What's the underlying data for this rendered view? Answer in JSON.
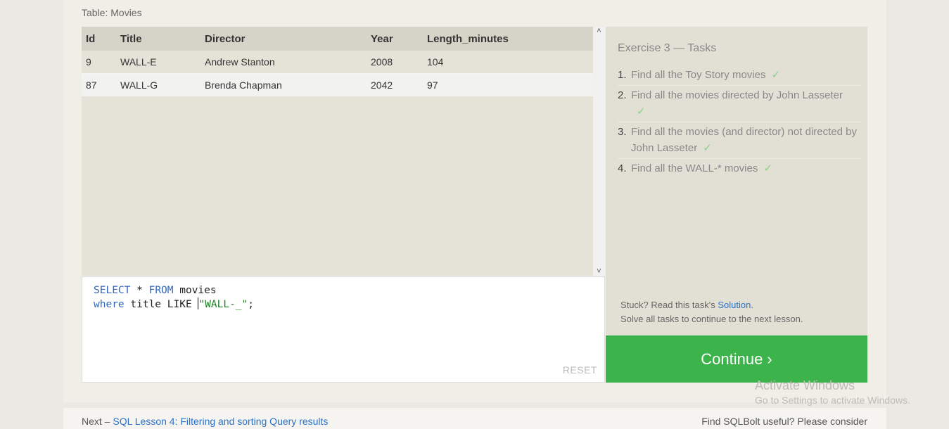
{
  "table_label": "Table: Movies",
  "columns": [
    "Id",
    "Title",
    "Director",
    "Year",
    "Length_minutes"
  ],
  "rows": [
    [
      "9",
      "WALL-E",
      "Andrew Stanton",
      "2008",
      "104"
    ],
    [
      "87",
      "WALL-G",
      "Brenda Chapman",
      "2042",
      "97"
    ]
  ],
  "editor": {
    "line1": {
      "kw1": "SELECT",
      "mid": " * ",
      "kw2": "FROM",
      "rest": " movies"
    },
    "line2": {
      "kw": "where",
      "mid": " title LIKE ",
      "str": "\"WALL-_\"",
      "end": ";"
    },
    "reset_label": "RESET"
  },
  "tasks": {
    "title": "Exercise 3 — Tasks",
    "items": [
      {
        "num": "1.",
        "text": "Find all the Toy Story movies",
        "check": "✓"
      },
      {
        "num": "2.",
        "text": "Find all the movies directed by John Lasseter",
        "check": "✓"
      },
      {
        "num": "3.",
        "text": "Find all the movies (and director) not directed by John Lasseter",
        "check": "✓"
      },
      {
        "num": "4.",
        "text": "Find all the WALL-* movies",
        "check": "✓"
      }
    ],
    "stuck_prefix": "Stuck? Read this task's",
    "solution_link": "Solution",
    "stuck_suffix": ".",
    "solve_all": "Solve all tasks to continue to the next lesson."
  },
  "continue_label": "Continue ›",
  "watermark": {
    "line1": "Activate Windows",
    "line2": "Go to Settings to activate Windows."
  },
  "footer": {
    "next_prefix": "Next –",
    "next_link": "SQL Lesson 4: Filtering and sorting Query results",
    "right_text": "Find SQLBolt useful? Please consider"
  },
  "colors": {
    "continue_bg": "#3cb34b",
    "link": "#2a72c8",
    "check": "#8ccf8a"
  }
}
